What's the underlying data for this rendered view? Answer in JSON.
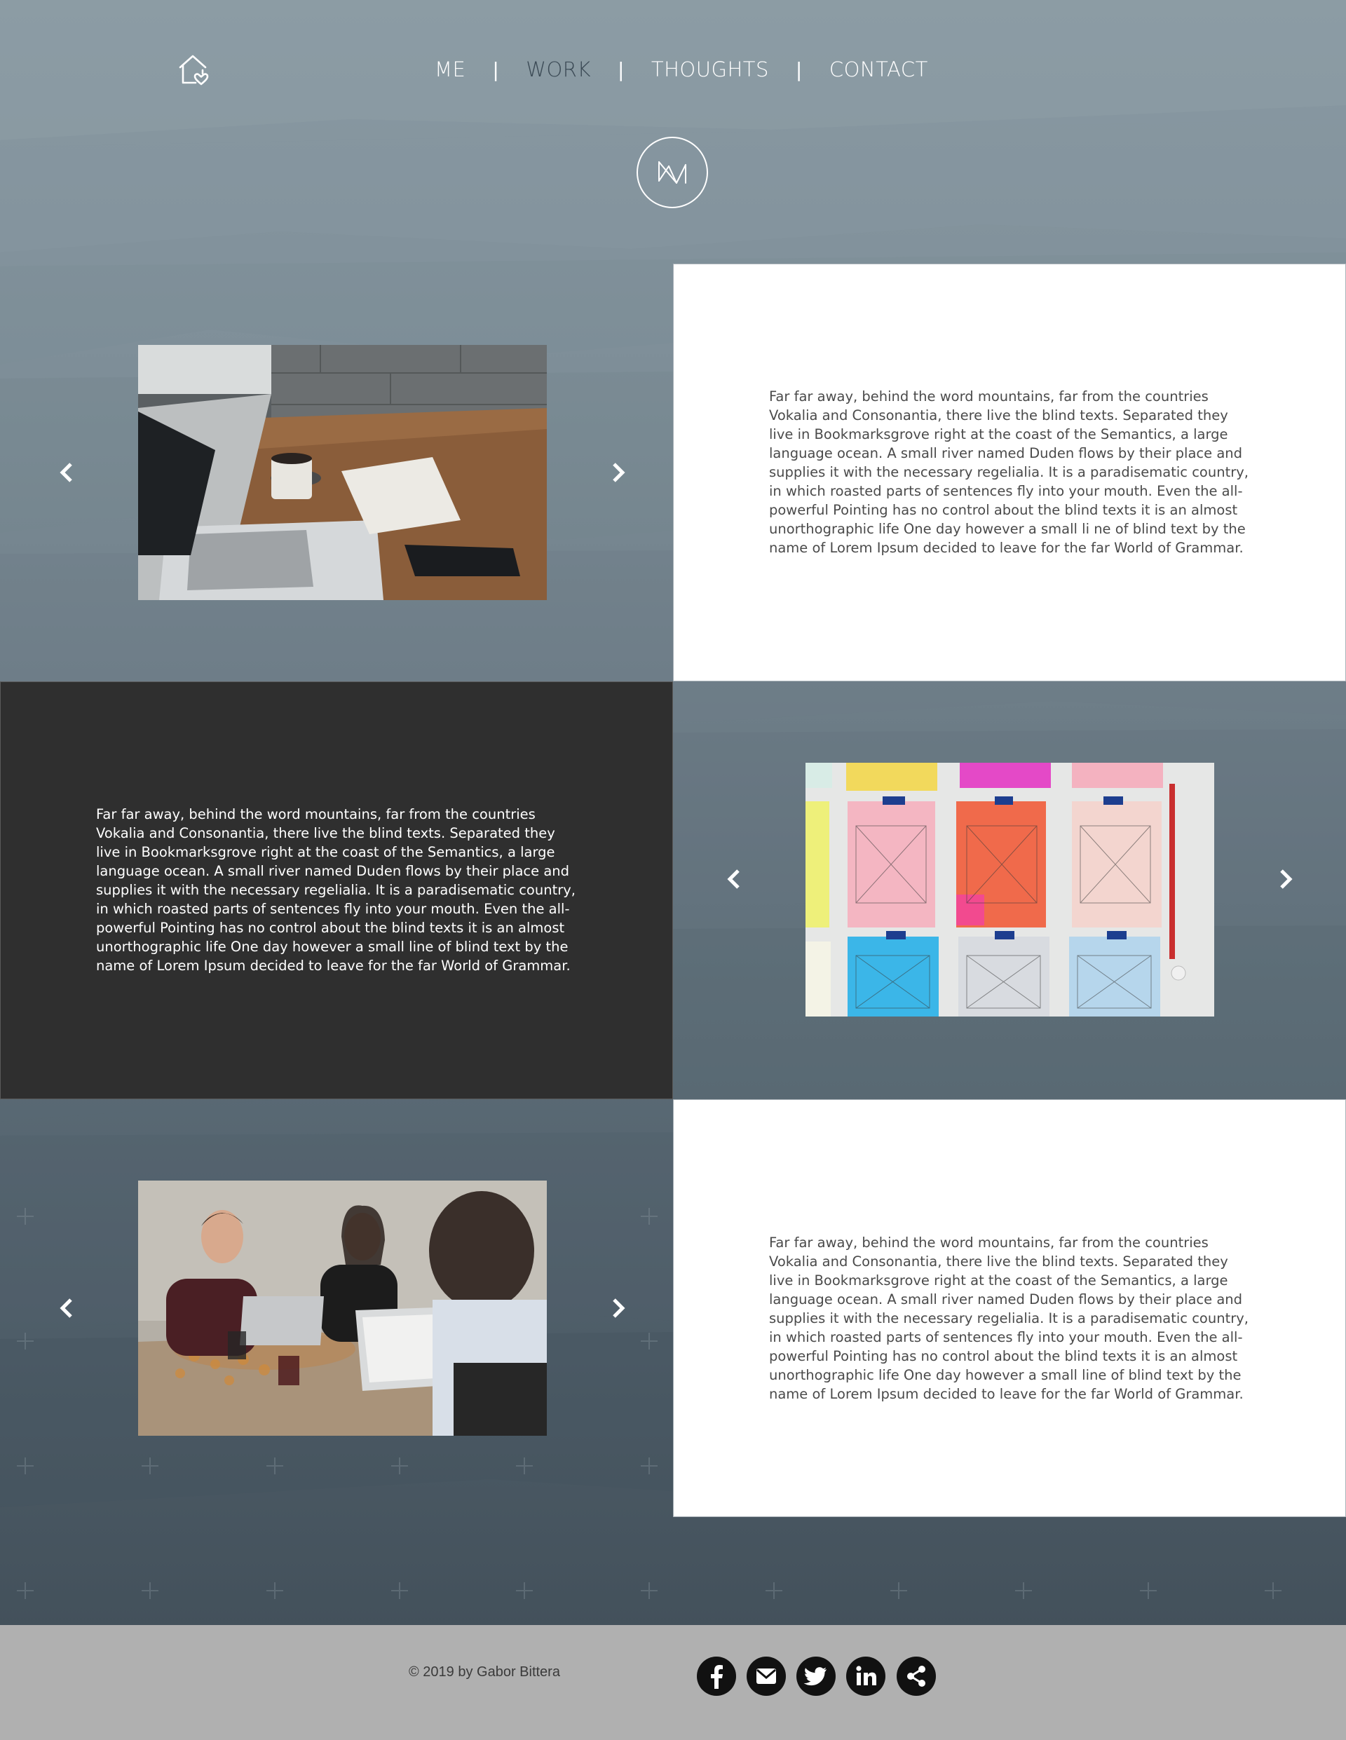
{
  "nav": {
    "items": [
      {
        "label": "ME"
      },
      {
        "label": "WORK"
      },
      {
        "label": "THOUGHTS"
      },
      {
        "label": "CONTACT"
      }
    ],
    "active": "WORK",
    "separator": "|"
  },
  "icons": {
    "home": "home-heart-icon",
    "logo": "monogram-logo",
    "prev": "chevron-left-icon",
    "next": "chevron-right-icon"
  },
  "sections": [
    {
      "photo": "desk-laptop-coffee-photo",
      "text_panel": "white",
      "text": "Far far away, behind the word mountains, far from the countries Vokalia and Consonantia, there live the blind texts. Separated they live in Bookmarksgrove right at the coast of the Semantics, a large language ocean. A small river named Duden flows by their place and supplies it with the necessary regelialia. It is a paradisematic country, in which roasted parts of sentences fly into your mouth. Even the all-powerful Pointing has no control about the blind texts it is an almost unorthographic life One day however a small li ne of blind text by the name of Lorem Ipsum decided to leave for the far World of Grammar."
    },
    {
      "photo": "sticky-notes-wireframes-photo",
      "text_panel": "dark",
      "text": "Far far away, behind the word mountains, far from the countries Vokalia and Consonantia, there live the blind texts. Separated they live in Bookmarksgrove right at the coast of the Semantics, a large language ocean. A small river named Duden flows by their place and supplies it with the necessary regelialia. It is a paradisematic country, in which roasted parts of sentences fly into your mouth. Even the all-powerful Pointing has no control about the blind texts it is an almost unorthographic life One day however a small line of blind text by the name of Lorem Ipsum decided to leave for the far World of Grammar."
    },
    {
      "photo": "team-meeting-laptops-photo",
      "text_panel": "white",
      "text": "Far far away, behind the word mountains, far from the countries Vokalia and Consonantia, there live the blind texts. Separated they live in Bookmarksgrove right at the coast of the Semantics, a large language ocean. A small river named Duden flows by their place and supplies it with the necessary regelialia. It is a paradisematic country, in which roasted parts of sentences fly into your mouth. Even the all-powerful Pointing has no control about the blind texts it is an almost unorthographic life One day however a small line of blind text by the name of Lorem Ipsum decided to leave for the far World of Grammar."
    }
  ],
  "footer": {
    "copyright": "© 2019 by Gabor Bittera",
    "social": [
      {
        "icon": "facebook-icon"
      },
      {
        "icon": "email-icon"
      },
      {
        "icon": "twitter-icon"
      },
      {
        "icon": "linkedin-icon"
      },
      {
        "icon": "share-icon"
      }
    ]
  },
  "colors": {
    "nav_active": "#3b4a55",
    "dark_panel": "#2f2f2f",
    "footer_bg": "#b0b0b0",
    "social_bg": "#111111"
  }
}
